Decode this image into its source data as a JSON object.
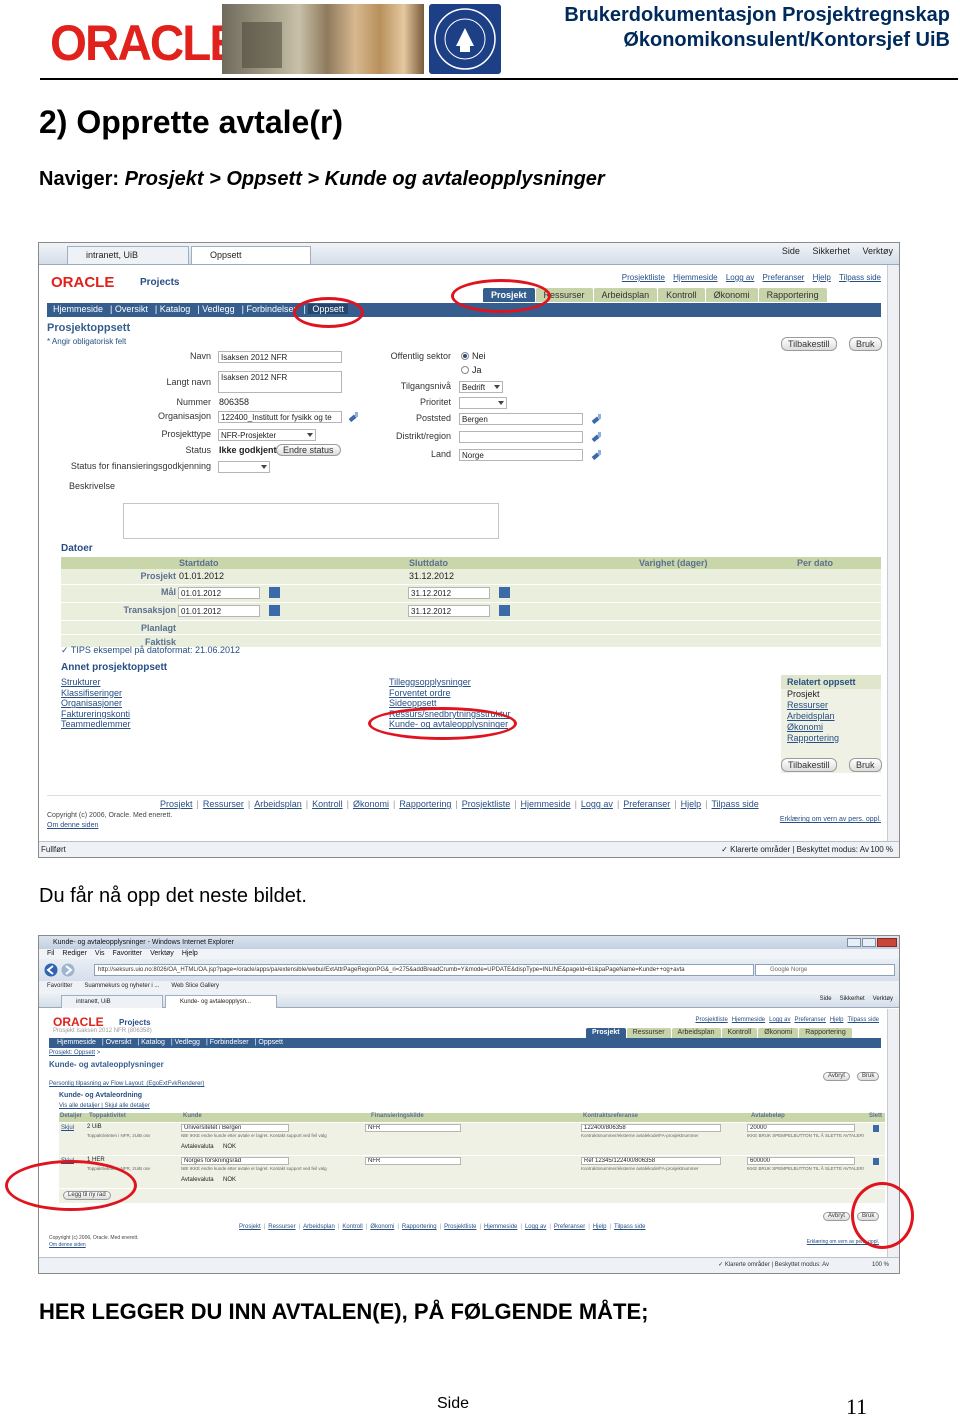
{
  "header": {
    "oracle_logo": "ORACLE",
    "title_line1": "Brukerdokumentasjon Prosjektregnskap",
    "title_line2": "Økonomikonsulent/Kontorsjef UiB",
    "seal_text": "UNIVERSITAS BERGENSIS"
  },
  "section": {
    "heading": "2) Opprette avtale(r)",
    "nav_prefix": "Naviger: ",
    "nav_path": "Prosjekt > Oppsett > Kunde og avtaleopplysninger"
  },
  "screenshot1": {
    "browser": {
      "tab1": "intranett, UiB",
      "tab2": "Oppsett",
      "tools": [
        "Side",
        "Sikkerhet",
        "Verktøy"
      ],
      "status_left": "Fullført",
      "status_right": "Klarerte områder | Beskyttet modus: Av",
      "zoom": "100 %"
    },
    "app": {
      "logo": "ORACLE",
      "product": "Projects",
      "toplinks": [
        "Prosjektliste",
        "Hjemmeside",
        "Logg av",
        "Preferanser",
        "Hjelp",
        "Tilpass side"
      ],
      "apptabs": [
        "Prosjekt",
        "Ressurser",
        "Arbeidsplan",
        "Kontroll",
        "Økonomi",
        "Rapportering"
      ],
      "nav": [
        "Hjemmeside",
        "Oversikt",
        "Katalog",
        "Vedlegg",
        "Forbindelser",
        "Oppsett"
      ],
      "page_title": "Prosjektoppsett",
      "required_note": "Angir obligatorisk felt",
      "buttons": {
        "back": "Tilbakestill",
        "use": "Bruk",
        "change_status": "Endre status"
      }
    },
    "form": {
      "left": [
        {
          "label": "Navn",
          "value": "Isaksen 2012 NFR"
        },
        {
          "label": "Langt navn",
          "value": "Isaksen 2012 NFR"
        },
        {
          "label": "Nummer",
          "value": "806358"
        },
        {
          "label": "Organisasjon",
          "value": "122400_Institutt for fysikk og te"
        },
        {
          "label": "Prosjekttype",
          "value": "NFR-Prosjekter"
        },
        {
          "label": "Status",
          "value": "Ikke godkjent"
        },
        {
          "label": "Status for finansieringsgodkjenning",
          "value": ""
        },
        {
          "label": "Beskrivelse",
          "value": ""
        }
      ],
      "right": [
        {
          "label": "Offentlig sektor",
          "value": ""
        },
        {
          "label": "Tilgangsnivå",
          "value": "Bedrift"
        },
        {
          "label": "Prioritet",
          "value": ""
        },
        {
          "label": "Poststed",
          "value": "Bergen"
        },
        {
          "label": "Distrikt/region",
          "value": ""
        },
        {
          "label": "Land",
          "value": "Norge"
        }
      ],
      "radio_options": [
        "Nei",
        "Ja"
      ]
    },
    "dates": {
      "heading": "Datoer",
      "columns": [
        "Startdato",
        "Sluttdato",
        "Varighet (dager)",
        "Per dato"
      ],
      "rows": [
        {
          "label": "Prosjekt",
          "start": "01.01.2012",
          "end": "31.12.2012"
        },
        {
          "label": "Mål",
          "start": "01.01.2012",
          "end": "31.12.2012"
        },
        {
          "label": "Transaksjon",
          "start": "01.01.2012",
          "end": "31.12.2012"
        },
        {
          "label": "Planlagt",
          "start": "",
          "end": ""
        },
        {
          "label": "Faktisk",
          "start": "",
          "end": ""
        }
      ],
      "tips": "TIPS eksempel på datoformat: 21.06.2012"
    },
    "other_setup": {
      "heading": "Annet prosjektoppsett",
      "col1": [
        "Strukturer",
        "Klassifiseringer",
        "Organisasjoner",
        "Faktureringskonti",
        "Teammedlemmer"
      ],
      "col2": [
        "Tilleggsopplysninger",
        "Forventet ordre",
        "Sideoppsett",
        "Ressurs/snedbrytningsstruktur",
        "Kunde- og avtaleopplysninger"
      ],
      "related_title": "Relatert oppsett",
      "related": [
        "Prosjekt",
        "Ressurser",
        "Arbeidsplan",
        "Økonomi",
        "Rapportering"
      ]
    },
    "footer": {
      "links": [
        "Prosjekt",
        "Ressurser",
        "Arbeidsplan",
        "Kontroll",
        "Økonomi",
        "Rapportering",
        "Prosjektliste",
        "Hjemmeside",
        "Logg av",
        "Preferanser",
        "Hjelp",
        "Tilpass side"
      ],
      "copyright": "Copyright (c) 2006, Oracle. Med enerett.",
      "about": "Om denne siden",
      "accessibility": "Erklæring om vern av pers. oppl."
    }
  },
  "paragraph": "Du får nå opp det neste bildet.",
  "screenshot2": {
    "window_title": "Kunde- og avtaleopplysninger - Windows Internet Explorer",
    "menu": [
      "Fil",
      "Rediger",
      "Vis",
      "Favoritter",
      "Verktøy",
      "Hjelp"
    ],
    "url": "http://seksurs.uio.no:8026/OA_HTML/OA.jsp?page=/oracle/apps/pa/extensible/webui/ExtAttrPageRegionPG&_ri=275&addBreadCrumb=Y&mode=UPDATE&dispType=INLINE&pageId=61&paPageName=Kunde++og+avta",
    "search_placeholder": "Google Norge",
    "favorites": [
      "Favoritter",
      "Suammekurs og nyheter i ...",
      "Web Slice Gallery"
    ],
    "tabs": [
      "intranett, UiB",
      "Kunde- og avtaleopplysn..."
    ],
    "tools": [
      "Side",
      "Sikkerhet",
      "Verktøy"
    ],
    "app": {
      "logo": "ORACLE",
      "product": "Projects",
      "subtitle": "Prosjekt Isaksen 2012 NFR (806358)",
      "toplinks": [
        "Prosjektliste",
        "Hjemmeside",
        "Logg av",
        "Preferanser",
        "Hjelp",
        "Tilpass side"
      ],
      "apptabs": [
        "Prosjekt",
        "Ressurser",
        "Arbeidsplan",
        "Kontroll",
        "Økonomi",
        "Rapportering"
      ],
      "nav": [
        "Hjemmeside",
        "Oversikt",
        "Katalog",
        "Vedlegg",
        "Forbindelser",
        "Oppsett"
      ],
      "breadcrumb": "Prosjekt: Oppsett",
      "page_title": "Kunde- og avtaleopplysninger",
      "personal_link": "Personlig tilpasning av Flow Layout: (EgoExtFvkRenderer)",
      "section_title": "Kunde- og Avtaleordning",
      "show_details": "Vis alle detaljer | Skjul alle detaljer",
      "columns": [
        "Detaljer",
        "Toppaktivitet",
        "Kunde",
        "Finansieringskilde",
        "Kontraktsreferanse",
        "Avtalebeløp",
        "Slett"
      ],
      "rows": [
        {
          "toggle": "Skjul",
          "activity": "2 UiB",
          "activity_hint": "Toppaktiviteten i NFR, 2UiB osv",
          "customer": "Universitetet i Bergen",
          "customer_hint": "NB! IKKE endre kunde etter avtale er lagret. Kontakt support ved feil valg",
          "funding": "NFR",
          "contract": "122400/806358",
          "contract_hint": "Kontraktsnummer/eksterne avtalekode/FA-prosjektnummer",
          "amount": "20000",
          "amount_hint": "IKKE BRUK SPEMPELBUTTON TIL Å SLETTE AVTALER!",
          "currency_label": "Avtalevaluta",
          "currency": "NOK"
        },
        {
          "toggle": "Skjul",
          "activity": "1 HER",
          "activity_hint": "Toppaktiviteten i NFR, 2UiB osv",
          "customer": "Norges forskningsråd",
          "customer_hint": "NB! IKKE endre kunde etter avtale er lagret. Kontakt support ved feil valg",
          "funding": "NFR",
          "contract": "Ref 12345/122400/806358",
          "contract_hint": "Kontraktsnummer/eksterne avtalekode/FA-prosjektnummer",
          "amount": "600000",
          "amount_hint": "IKKE BRUK SPEMPELBUTTON TIL Å SLETTE AVTALER!",
          "currency_label": "Avtalevaluta",
          "currency": "NOK"
        }
      ],
      "add_row": "Legg til ny rad",
      "buttons": {
        "cancel": "Avbryt",
        "use": "Bruk"
      },
      "footer_links": [
        "Prosjekt",
        "Ressurser",
        "Arbeidsplan",
        "Kontroll",
        "Økonomi",
        "Rapportering",
        "Prosjektliste",
        "Hjemmeside",
        "Logg av",
        "Preferanser",
        "Hjelp",
        "Tilpass side"
      ],
      "copyright": "Copyright (c) 2006, Oracle. Med enerett.",
      "about": "Om denne siden",
      "accessibility": "Erklæring om vern av pers. oppl."
    },
    "status_right": "Klarerte områder | Beskyttet modus: Av",
    "zoom": "100 %"
  },
  "bottom_heading": "HER LEGGER DU INN AVTALEN(E), PÅ FØLGENDE MÅTE;",
  "footer": {
    "label": "Side",
    "page": "11"
  },
  "colors": {
    "oracle_red": "#e0211c",
    "title_blue": "#002a5c",
    "annotation_red": "#e0141e",
    "app_blue": "#355e8f"
  }
}
